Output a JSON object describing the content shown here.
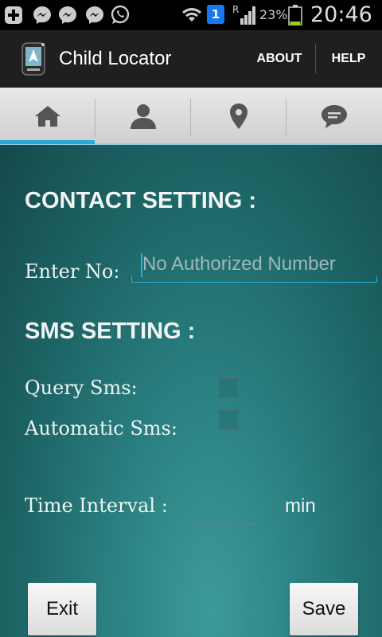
{
  "status_bar": {
    "battery_percent": "23%",
    "time": "20:46",
    "sim_badge": "1",
    "roaming_letter": "R",
    "icons": [
      "plus-icon",
      "messenger-icon",
      "messenger-icon",
      "messenger-icon",
      "whatsapp-icon",
      "wifi-icon",
      "sim-badge-icon",
      "signal-icon",
      "battery-icon"
    ],
    "battery_level": 0.23,
    "battery_color": "#9bd31e"
  },
  "action_bar": {
    "title": "Child Locator",
    "about_label": "ABOUT",
    "help_label": "HELP"
  },
  "tabs": {
    "items": [
      {
        "icon": "home-icon",
        "selected": true
      },
      {
        "icon": "person-icon",
        "selected": false
      },
      {
        "icon": "location-pin-icon",
        "selected": false
      },
      {
        "icon": "chat-icon",
        "selected": false
      }
    ],
    "indicator_color": "#2aa8d8"
  },
  "contact_setting": {
    "heading": "CONTACT SETTING :",
    "number_label": "Enter No:",
    "number_value": "",
    "number_placeholder": "No Authorized Number"
  },
  "sms_setting": {
    "heading": "SMS  SETTING :",
    "query_sms_label": "Query Sms:",
    "query_sms_checked": false,
    "automatic_sms_label": "Automatic Sms:",
    "automatic_sms_checked": false,
    "time_interval_label": "Time Interval :",
    "time_interval_value": "",
    "time_interval_unit": "min"
  },
  "buttons": {
    "exit_label": "Exit",
    "save_label": "Save"
  }
}
